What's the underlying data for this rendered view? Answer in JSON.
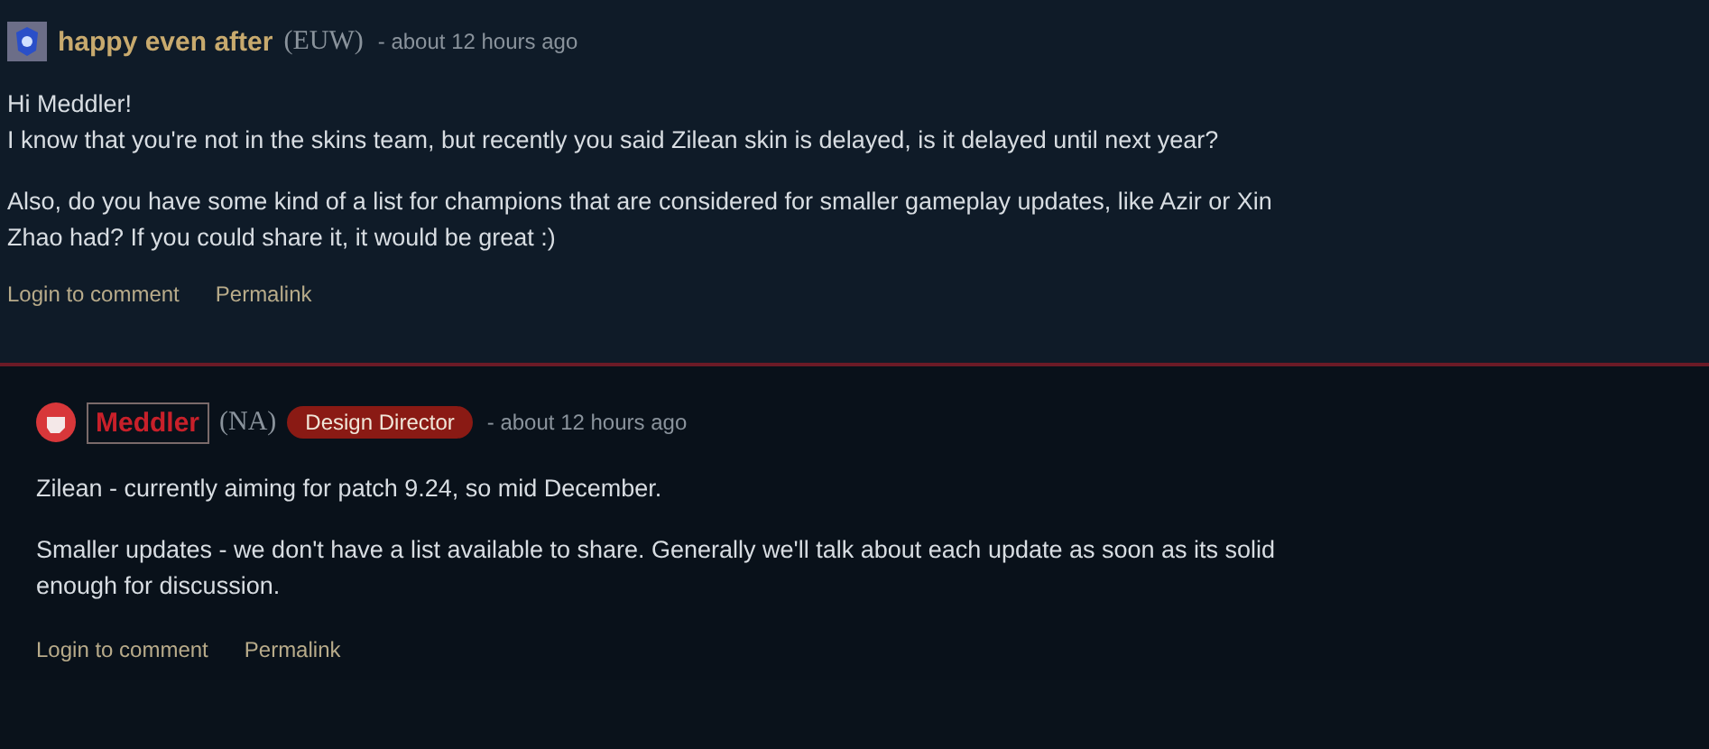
{
  "comments": [
    {
      "kind": "post",
      "author": "happy even after",
      "region": "(EUW)",
      "time": "- about 12 hours ago",
      "paragraphs": [
        [
          "Hi Meddler!",
          "I know that you're not in the skins team, but recently you said Zilean skin is delayed, is it delayed until next year?"
        ],
        [
          "Also, do you have some kind of a list for champions that are considered for smaller gameplay updates, like Azir or Xin Zhao had? If you could share it, it would be great :)"
        ]
      ],
      "actions": [
        "Login to comment",
        "Permalink"
      ]
    },
    {
      "kind": "reply",
      "author": "Meddler",
      "region": "(NA)",
      "badge": "Design Director",
      "time": "- about 12 hours ago",
      "paragraphs": [
        [
          "Zilean - currently aiming for patch 9.24, so mid December."
        ],
        [
          "Smaller updates - we don't have a list available to share. Generally we'll talk about each update as soon as its solid enough for discussion."
        ]
      ],
      "actions": [
        "Login to comment",
        "Permalink"
      ]
    }
  ]
}
